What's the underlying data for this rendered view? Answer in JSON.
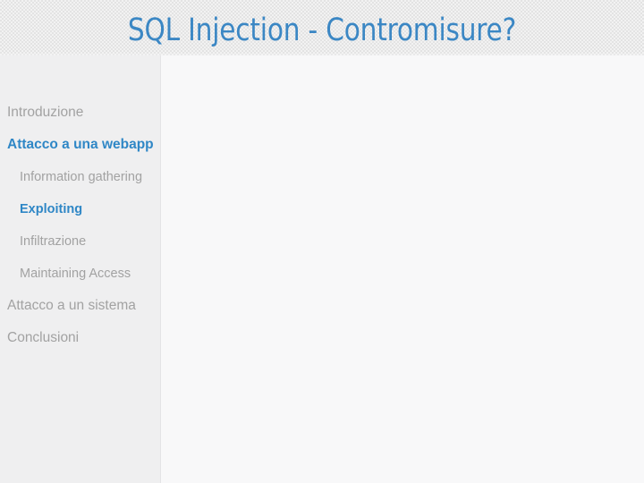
{
  "slide": {
    "title": "SQL Injection - Contromisure?",
    "title_color": "#3b87c4",
    "header_background": "#f2f2f2",
    "sidebar_background": "#efeff0",
    "content_background": "#f8f8f9"
  },
  "sidebar": {
    "inactive_color": "#a2a2a2",
    "active_color": "#2f87c6",
    "items": [
      {
        "label": "Introduzione",
        "level": 0,
        "active": false
      },
      {
        "label": "Attacco a una webapp",
        "level": 0,
        "active": true
      },
      {
        "label": "Information gathering",
        "level": 1,
        "active": false
      },
      {
        "label": "Exploiting",
        "level": 1,
        "active": true
      },
      {
        "label": "Infiltrazione",
        "level": 1,
        "active": false
      },
      {
        "label": "Maintaining Access",
        "level": 1,
        "active": false
      },
      {
        "label": "Attacco a un sistema",
        "level": 0,
        "active": false
      },
      {
        "label": "Conclusioni",
        "level": 0,
        "active": false
      }
    ]
  },
  "content": {
    "body_text": ""
  }
}
